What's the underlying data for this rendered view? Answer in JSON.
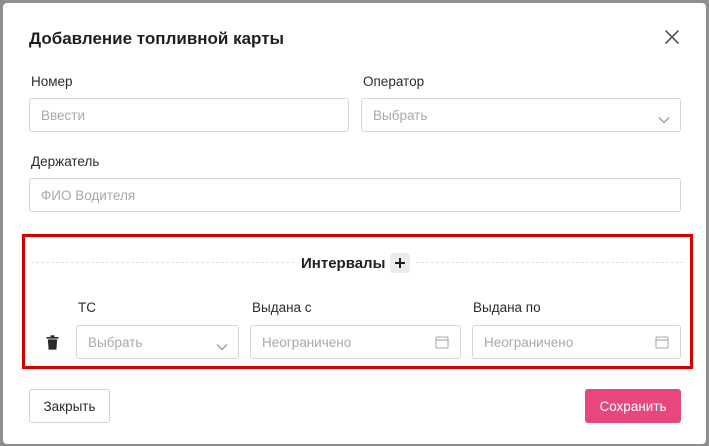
{
  "dialog": {
    "title": "Добавление топливной карты"
  },
  "form": {
    "number": {
      "label": "Номер",
      "placeholder": "Ввести"
    },
    "operator": {
      "label": "Оператор",
      "placeholder": "Выбрать"
    },
    "holder": {
      "label": "Держатель",
      "placeholder": "ФИО Водителя"
    }
  },
  "intervals": {
    "title": "Интервалы",
    "columns": {
      "vehicle": "ТС",
      "issued_from": "Выдана с",
      "issued_to": "Выдана по"
    },
    "row": {
      "vehicle_placeholder": "Выбрать",
      "issued_from_placeholder": "Неограничено",
      "issued_to_placeholder": "Неограничено"
    }
  },
  "footer": {
    "close_label": "Закрыть",
    "save_label": "Сохранить"
  },
  "colors": {
    "primary": "#e8467f",
    "highlight_border": "#d60000"
  },
  "icons": [
    "close-icon",
    "chevron-down-icon",
    "plus-icon",
    "trash-icon",
    "calendar-icon"
  ]
}
